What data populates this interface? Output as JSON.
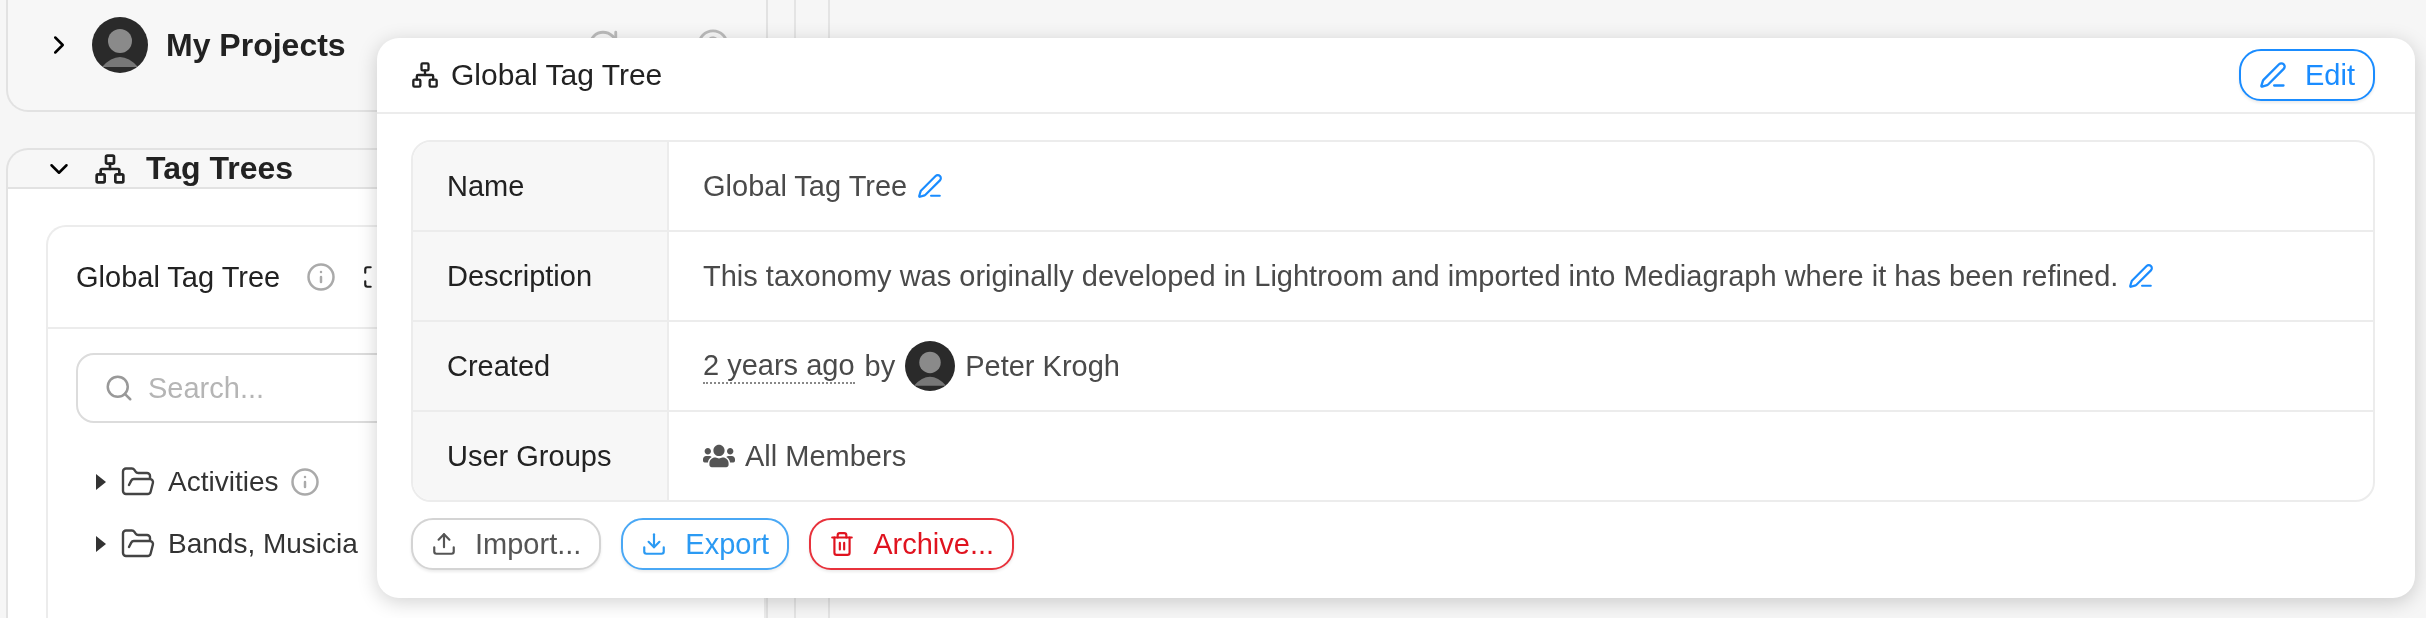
{
  "sidebar": {
    "projects": {
      "title": "My Projects",
      "expanded": false
    },
    "tag_trees": {
      "title": "Tag Trees",
      "expanded": true,
      "tree_card": {
        "title": "Global Tag Tree",
        "search": {
          "placeholder": "Search..."
        },
        "items": [
          {
            "label": "Activities",
            "expanded": false,
            "info": true
          },
          {
            "label": "Bands, Musicia",
            "expanded": false,
            "info": false
          }
        ]
      }
    }
  },
  "popover": {
    "title": "Global Tag Tree",
    "edit_button": "Edit",
    "rows": [
      {
        "label": "Name",
        "kind": "editable",
        "value": "Global Tag Tree"
      },
      {
        "label": "Description",
        "kind": "editable",
        "value": "This taxonomy was originally developed in Lightroom and imported into Mediagraph where it has been refined."
      },
      {
        "label": "Created",
        "kind": "created",
        "time": "2 years ago",
        "by": "by",
        "user": "Peter Krogh"
      },
      {
        "label": "User Groups",
        "kind": "group",
        "value": "All Members"
      }
    ],
    "actions": [
      {
        "label": "Import...",
        "kind": "import"
      },
      {
        "label": "Export",
        "kind": "export"
      },
      {
        "label": "Archive...",
        "kind": "archive"
      }
    ]
  }
}
